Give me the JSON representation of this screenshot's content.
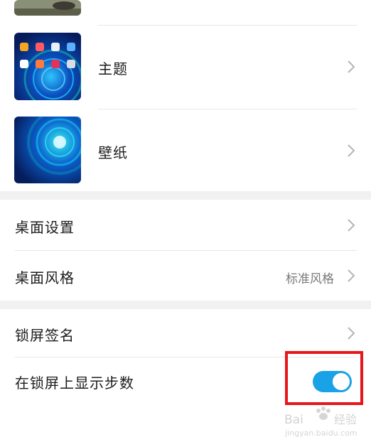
{
  "items": {
    "theme": {
      "label": "主题"
    },
    "wallpaper": {
      "label": "壁纸"
    },
    "desktop_settings": {
      "label": "桌面设置"
    },
    "desktop_style": {
      "label": "桌面风格",
      "value": "标准风格"
    },
    "lockscreen_signature": {
      "label": "锁屏签名"
    },
    "show_steps": {
      "label": "在锁屏上显示步数",
      "enabled": true
    }
  },
  "colors": {
    "toggle_on": "#1aa2e6",
    "highlight": "#e8161c"
  },
  "icons": [
    "chevron-right-icon",
    "theme-preview-thumbnail",
    "wallpaper-preview-thumbnail"
  ]
}
